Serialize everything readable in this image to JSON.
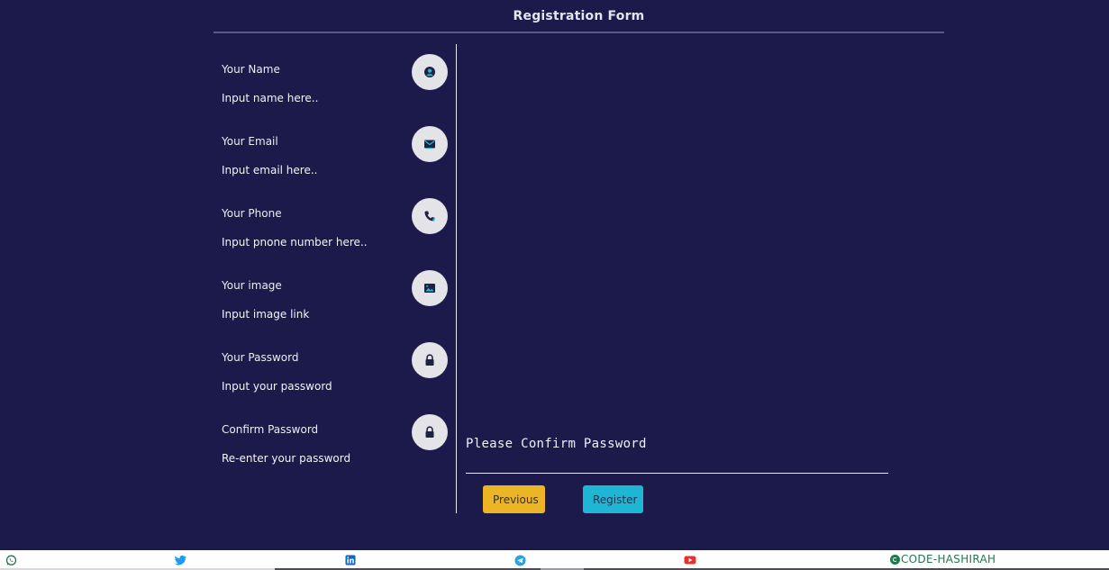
{
  "form": {
    "title": "Registration Form",
    "fields": [
      {
        "label": "Your Name",
        "input": "Input name here..",
        "icon": "user-icon"
      },
      {
        "label": "Your Email",
        "input": "Input email here..",
        "icon": "envelope-icon"
      },
      {
        "label": "Your Phone",
        "input": "Input pnone number here..",
        "icon": "phone-icon"
      },
      {
        "label": "Your image",
        "input": "Input image link",
        "icon": "image-icon"
      },
      {
        "label": "Your Password",
        "input": "Input your password",
        "icon": "lock-icon"
      },
      {
        "label": "Confirm Password",
        "input": "Re-enter your password",
        "icon": "lock-icon"
      }
    ],
    "step_prompt": "Please Confirm Password",
    "previous_label": "Previous",
    "register_label": "Register"
  },
  "footer": {
    "social_icons": [
      "whatsapp-icon",
      "twitter-icon",
      "linkedin-icon",
      "telegram-icon",
      "youtube-icon"
    ],
    "brand": "CODE-HASHIRAH"
  },
  "colors": {
    "background": "#1b1a4a",
    "icon_circle": "#e3e3e8",
    "icon_accent": "#17b8d8",
    "previous_button": "#ecb525",
    "register_button": "#1fb6d6",
    "brand": "#1c7a4c"
  }
}
